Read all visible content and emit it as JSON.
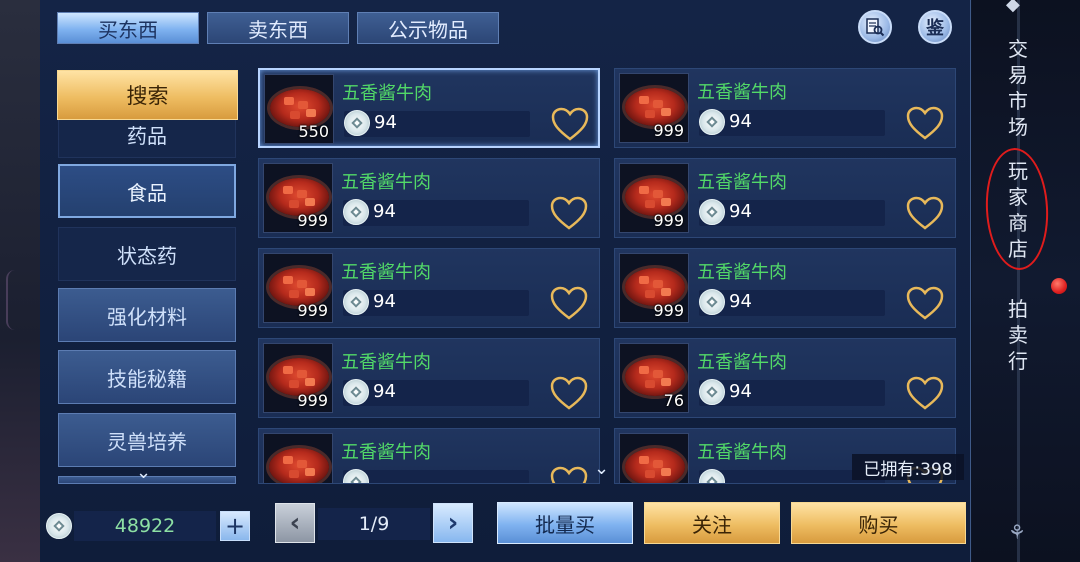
{
  "tabs": [
    {
      "label": "买东西",
      "active": true
    },
    {
      "label": "卖东西",
      "active": false
    },
    {
      "label": "公示物品",
      "active": false
    }
  ],
  "top_icons": {
    "ledger_icon": "ledger-search-icon",
    "appraise_label": "鉴"
  },
  "sidebar": {
    "search_label": "搜索",
    "items": [
      {
        "label": "药品"
      },
      {
        "label": "食品",
        "selected": true
      },
      {
        "label": "状态药"
      },
      {
        "label": "强化材料"
      },
      {
        "label": "技能秘籍"
      },
      {
        "label": "灵兽培养"
      }
    ]
  },
  "items": [
    {
      "name": "五香酱牛肉",
      "qty": "550",
      "price": "94"
    },
    {
      "name": "五香酱牛肉",
      "qty": "999",
      "price": "94"
    },
    {
      "name": "五香酱牛肉",
      "qty": "999",
      "price": "94"
    },
    {
      "name": "五香酱牛肉",
      "qty": "999",
      "price": "94"
    },
    {
      "name": "五香酱牛肉",
      "qty": "999",
      "price": "94"
    },
    {
      "name": "五香酱牛肉",
      "qty": "999",
      "price": "94"
    },
    {
      "name": "五香酱牛肉",
      "qty": "999",
      "price": "94"
    },
    {
      "name": "五香酱牛肉",
      "qty": "76",
      "price": "94"
    },
    {
      "name": "五香酱牛肉",
      "qty": "",
      "price": ""
    },
    {
      "name": "五香酱牛肉",
      "qty": "",
      "price": ""
    }
  ],
  "owned": "已拥有:398",
  "bottom": {
    "balance": "48922",
    "plus_label": "+",
    "page": "1/9",
    "prev_label": "‹",
    "next_label": "›",
    "bulk_buy": "批量买",
    "follow": "关注",
    "buy": "购买"
  },
  "right_nav": {
    "trading_market": "交易市场",
    "player_shop": "玩家商店",
    "auction_house": "拍卖行"
  },
  "colors": {
    "item_name": "#52d968",
    "accent_gold": "#eebd62",
    "accent_blue": "#7fb2f0",
    "annotation_red": "#e01c1c"
  }
}
